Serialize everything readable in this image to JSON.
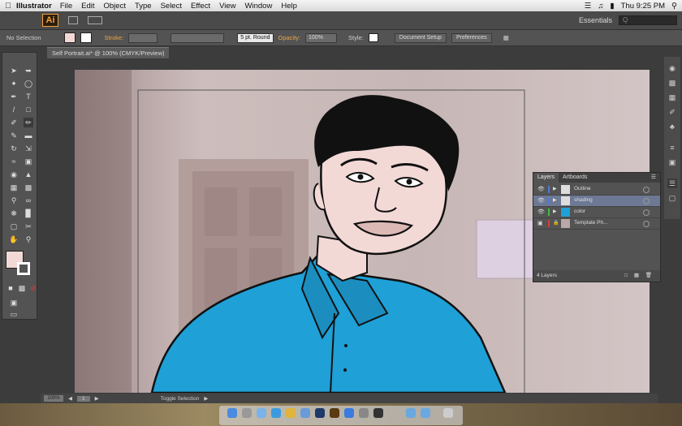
{
  "menubar": {
    "apple": "",
    "app": "Illustrator",
    "items": [
      "File",
      "Edit",
      "Object",
      "Type",
      "Select",
      "Effect",
      "View",
      "Window",
      "Help"
    ],
    "clock": "Thu 9:25 PM"
  },
  "appbar": {
    "logo": "Ai",
    "workspace": "Essentials",
    "search_placeholder": "Q"
  },
  "controlbar": {
    "selection": "No Selection",
    "stroke_label": "Stroke:",
    "brush": "5 pt. Round",
    "opacity_label": "Opacity:",
    "opacity": "100%",
    "style_label": "Style:",
    "doc_setup": "Document Setup",
    "preferences": "Preferences"
  },
  "document": {
    "tab": "Self Portrait.ai* @ 100% (CMYK/Preview)"
  },
  "layers_panel": {
    "tabs": [
      "Layers",
      "Artboards"
    ],
    "rows": [
      {
        "name": "Outline",
        "color": "#4f7bd9"
      },
      {
        "name": "shading",
        "color": "#4f7bd9"
      },
      {
        "name": "color",
        "color": "#3cc13c"
      },
      {
        "name": "Template Ph...",
        "color": "#d93c3c"
      }
    ],
    "footer": "4 Layers"
  },
  "statusbar": {
    "zoom": "100%",
    "page": "1",
    "tool": "Toggle Selection"
  },
  "colors": {
    "shirt": "#1fa0d6",
    "skin": "#f3d9d6",
    "canvas_bg": "#c8b8b7",
    "accent": "#f7a23b"
  }
}
